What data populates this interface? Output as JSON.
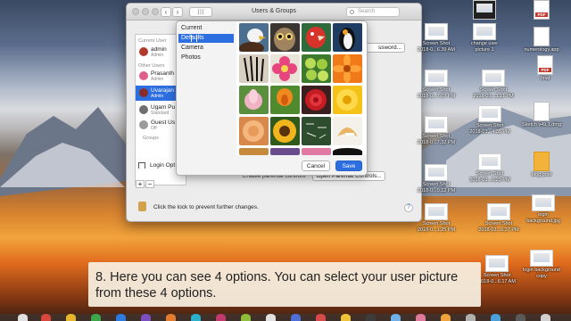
{
  "window": {
    "title": "Users & Groups",
    "search_placeholder": "Search",
    "nav_back": "‹",
    "nav_forward": "›",
    "grid_label": "⁝⁝⁝"
  },
  "sidebar": {
    "current_user_header": "Current User",
    "other_users_header": "Other Users",
    "groups_label": "Groups",
    "users": [
      {
        "name": "admin",
        "role": "Admin",
        "color": "#b23a2a"
      },
      {
        "name": "Prasanth",
        "role": "Admin",
        "color": "#e05f8a"
      },
      {
        "name": "Uvarajan",
        "role": "Admin",
        "color": "#8a2b2b"
      },
      {
        "name": "Ugam Pu",
        "role": "Standard",
        "color": "#6f6f6f"
      },
      {
        "name": "Guest Us",
        "role": "Off",
        "color": "#9a9a9a"
      }
    ],
    "login_options": "Login Opt",
    "add": "+",
    "remove": "−"
  },
  "main": {
    "password_button": "ssword...",
    "parental_checkbox": "Enable parental controls",
    "parental_button": "Open Parental Controls..."
  },
  "footer": {
    "lock_text": "Click the lock to prevent further changes.",
    "help": "?"
  },
  "picker": {
    "menu": [
      "Current",
      "Defaults",
      "Camera",
      "Photos"
    ],
    "selected": "Defaults",
    "tiles": [
      "eagle",
      "owl",
      "parrot",
      "penguin",
      "zebra",
      "pink-flower",
      "lime",
      "orange-flower",
      "lotus",
      "tulip",
      "red-rose",
      "sunflower",
      "peach-rose",
      "daisy",
      "chalkboard",
      "fortune-cookie"
    ],
    "cancel": "Cancel",
    "save": "Save"
  },
  "desktop_icons": [
    {
      "label": "",
      "kind": "thumb"
    },
    {
      "label": "PDF",
      "kind": "pdf"
    },
    {
      "label": "Screen Shot\n2018-0...6.39 AM",
      "kind": "thumb"
    },
    {
      "label": "change user\npicture 1",
      "kind": "thumb"
    },
    {
      "label": "numerology.app",
      "kind": "pdf"
    },
    {
      "label": "Screen Shot\n2018-0...7.07 PM",
      "kind": "thumb"
    },
    {
      "label": "Screen Shot\n2018-03...3.21 PM",
      "kind": "thumb"
    },
    {
      "label": "final",
      "kind": "pdf"
    },
    {
      "label": "Screen Shot\n2018-0...7.32 PM",
      "kind": "thumb"
    },
    {
      "label": "Screen Shot\n2018-03...4.38 PM",
      "kind": "thumb"
    },
    {
      "label": "Sketch v49.1.dmg",
      "kind": "doc"
    },
    {
      "label": "Screen Shot\n2018-0...0.12 PM",
      "kind": "thumb"
    },
    {
      "label": "Screen Shot\n2018-03...6.29 PM",
      "kind": "thumb"
    },
    {
      "label": "blog post",
      "kind": "sketch"
    },
    {
      "label": "Screen Shot\n2018-0...1.25 PM",
      "kind": "thumb"
    },
    {
      "label": "Screen Shot\n2018-03...6.37 PM",
      "kind": "thumb"
    },
    {
      "label": "login\nbackground.jpg",
      "kind": "thumb"
    },
    {
      "label": "Screen Shot\n2018-0...6.17 AM",
      "kind": "thumb"
    },
    {
      "label": "login background\ncopy",
      "kind": "thumb"
    }
  ],
  "caption": "8. Here you can see 4 options. You can select your user picture from these 4 options."
}
